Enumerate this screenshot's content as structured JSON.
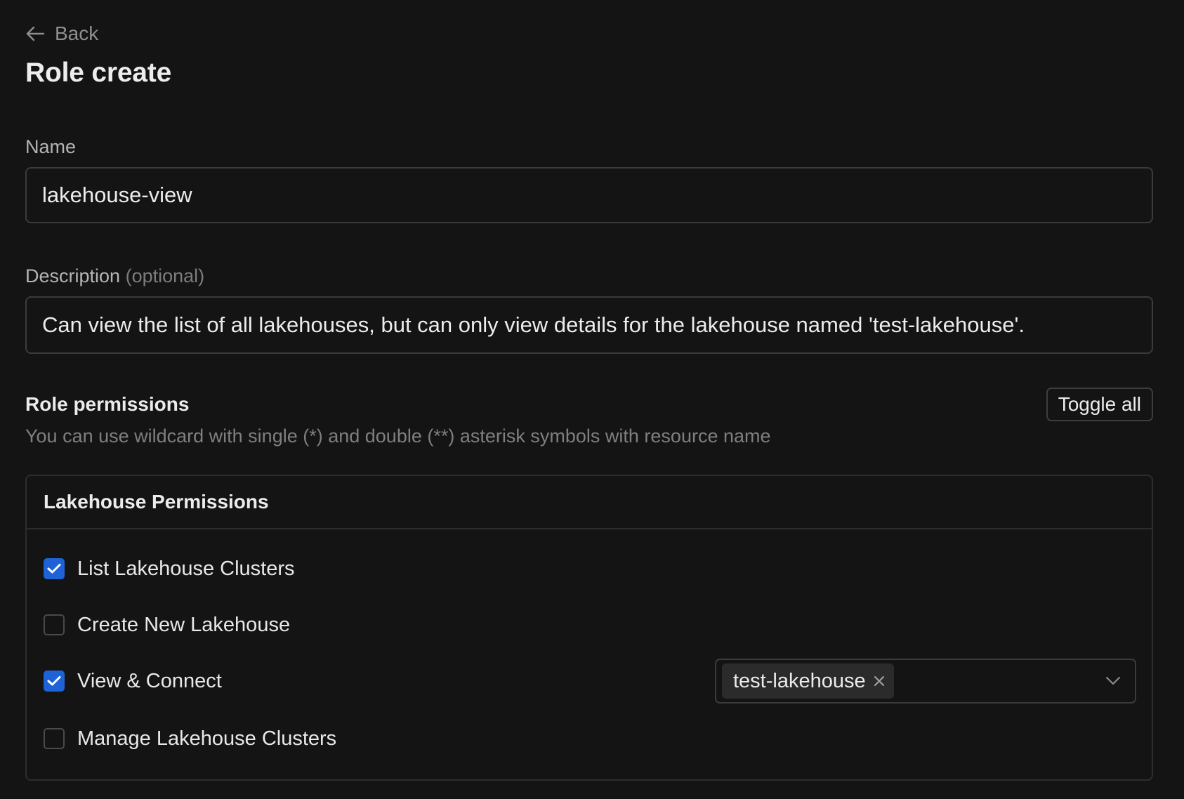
{
  "header": {
    "back_label": "Back",
    "title": "Role create"
  },
  "form": {
    "name": {
      "label": "Name",
      "value": "lakehouse-view"
    },
    "description": {
      "label": "Description",
      "optional_label": "(optional)",
      "value": "Can view the list of all lakehouses, but can only view details for the lakehouse named 'test-lakehouse'."
    }
  },
  "permissions": {
    "title": "Role permissions",
    "hint": "You can use wildcard with single (*) and double (**) asterisk symbols with resource name",
    "toggle_all_label": "Toggle all",
    "group": {
      "title": "Lakehouse Permissions",
      "items": [
        {
          "label": "List Lakehouse Clusters",
          "checked": true
        },
        {
          "label": "Create New Lakehouse",
          "checked": false
        },
        {
          "label": "View & Connect",
          "checked": true,
          "selected_resources": [
            "test-lakehouse"
          ]
        },
        {
          "label": "Manage Lakehouse Clusters",
          "checked": false
        }
      ]
    }
  },
  "colors": {
    "background": "#141414",
    "checkbox_checked": "#1f62d6"
  },
  "icons": {
    "back": "arrow-left-icon",
    "check": "check-icon",
    "tag_remove": "close-icon",
    "dropdown": "chevron-down-icon"
  }
}
